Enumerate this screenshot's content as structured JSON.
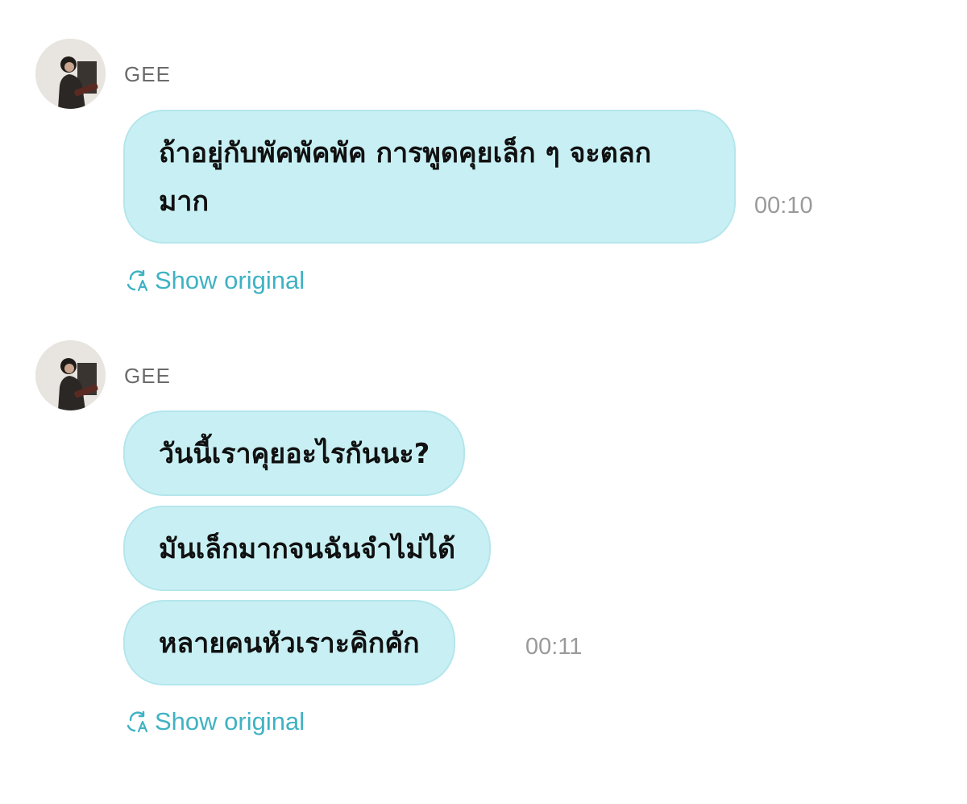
{
  "chat": {
    "groups": [
      {
        "sender": "GEE",
        "messages": [
          {
            "text": "ถ้าอยู่กับพัคพัคพัค การพูดคุยเล็ก ๆ จะตลกมาก"
          }
        ],
        "time": "00:10",
        "show_original": "Show original"
      },
      {
        "sender": "GEE",
        "messages": [
          {
            "text": "วันนี้เราคุยอะไรกันนะ?"
          },
          {
            "text": "มันเล็กมากจนฉันจำไม่ได้"
          },
          {
            "text": "หลายคนหัวเราะคิกคัก"
          }
        ],
        "time": "00:11",
        "show_original": "Show original"
      }
    ]
  },
  "icons": {
    "avatar": "avatar-photo",
    "translate": "translate-icon"
  },
  "colors": {
    "bubble": "#c8f0f4",
    "bubble_border": "#b4e6ec",
    "accent": "#3fb2c3",
    "time": "#9a9a9a",
    "sender": "#6b6b6b"
  }
}
